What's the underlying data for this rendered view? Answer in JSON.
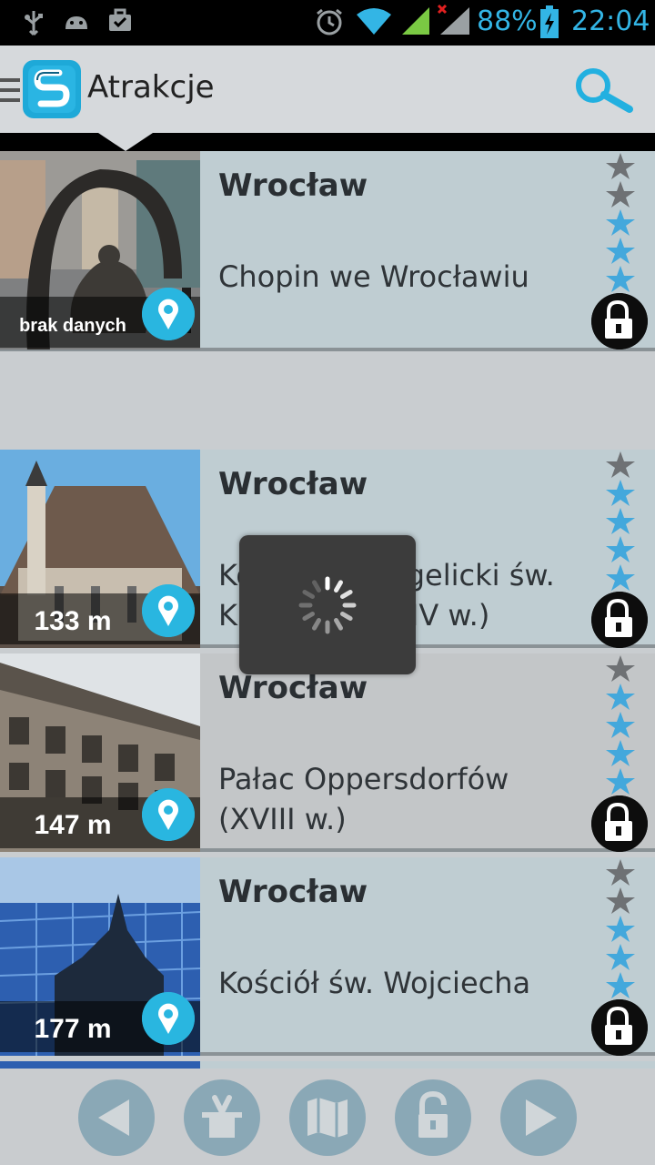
{
  "status_bar": {
    "icons": [
      "usb-icon",
      "android-debug-icon",
      "briefcase-icon",
      "alarm-icon",
      "wifi-icon",
      "signal-icon",
      "signal-no-data-icon",
      "battery-charging-icon"
    ],
    "battery": "88%",
    "time": "22:04"
  },
  "app_bar": {
    "title": "Atrakcje",
    "icons": [
      "menu-icon",
      "app-logo",
      "search-icon"
    ]
  },
  "items": [
    {
      "city": "Wrocław",
      "name": "Chopin we Wrocławiu",
      "distance": "brak danych",
      "rating": 3
    },
    {
      "city": "Wrocław",
      "name": "Kościół ewangelicki św. Krzysztofa (XIV w.)",
      "distance": "133 m",
      "rating": 4
    },
    {
      "city": "Wrocław",
      "name": "Pałac Oppersdorfów (XVIII w.)",
      "distance": "147 m",
      "rating": 4
    },
    {
      "city": "Wrocław",
      "name": "Kościół św. Wojciecha",
      "distance": "177 m",
      "rating": 3
    }
  ],
  "loading": {
    "icon": "loading-spinner"
  },
  "bottom_nav": {
    "icons": [
      "prev-icon",
      "magic-hat-icon",
      "map-icon",
      "unlock-icon",
      "next-icon"
    ]
  },
  "colors": {
    "accent": "#33b5e5",
    "pin": "#29b6e0",
    "row_bg": "#bfcdd2",
    "star_active": "#43a8dc",
    "star_inactive": "#6e7174",
    "nav_button": "#8aa8b6"
  }
}
